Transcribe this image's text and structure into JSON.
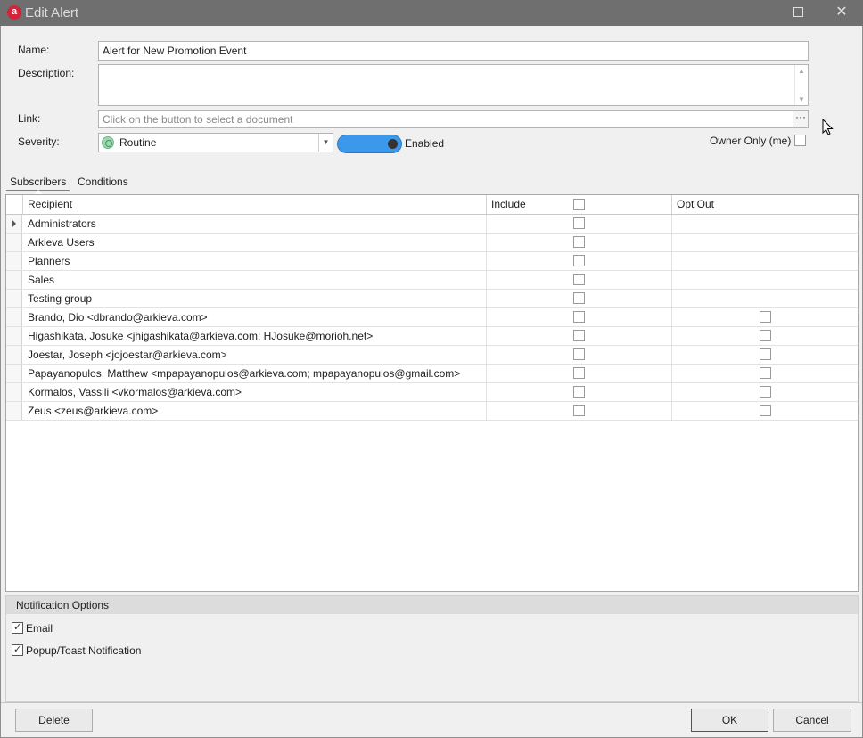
{
  "window": {
    "title": "Edit Alert",
    "logo_letter": "a"
  },
  "form": {
    "name_label": "Name:",
    "name_value": "Alert for New Promotion Event",
    "description_label": "Description:",
    "description_value": "",
    "link_label": "Link:",
    "link_placeholder": "Click on the button to select a document",
    "link_button": "···",
    "severity_label": "Severity:",
    "severity_value": "Routine",
    "enabled_label": "Enabled",
    "enabled": true,
    "owner_only_label": "Owner Only (me)",
    "owner_only": false
  },
  "tabs": [
    {
      "label": "Subscribers",
      "active": true
    },
    {
      "label": "Conditions",
      "active": false
    }
  ],
  "grid": {
    "columns": [
      "Recipient",
      "Include",
      "Opt Out"
    ],
    "include_all": false,
    "rows": [
      {
        "recipient": "Administrators",
        "include": false,
        "optout": null,
        "current": true
      },
      {
        "recipient": "Arkieva Users",
        "include": false,
        "optout": null
      },
      {
        "recipient": "Planners",
        "include": false,
        "optout": null
      },
      {
        "recipient": "Sales",
        "include": false,
        "optout": null
      },
      {
        "recipient": "Testing group",
        "include": false,
        "optout": null
      },
      {
        "recipient": "Brando, Dio <dbrando@arkieva.com>",
        "include": false,
        "optout": false
      },
      {
        "recipient": "Higashikata, Josuke <jhigashikata@arkieva.com; HJosuke@morioh.net>",
        "include": false,
        "optout": false
      },
      {
        "recipient": "Joestar, Joseph <jojoestar@arkieva.com>",
        "include": false,
        "optout": false
      },
      {
        "recipient": "Papayanopulos, Matthew <mpapayanopulos@arkieva.com; mpapayanopulos@gmail.com>",
        "include": false,
        "optout": false
      },
      {
        "recipient": "Kormalos, Vassili <vkormalos@arkieva.com>",
        "include": false,
        "optout": false
      },
      {
        "recipient": "Zeus <zeus@arkieva.com>",
        "include": false,
        "optout": false
      }
    ]
  },
  "notification": {
    "title": "Notification Options",
    "options": [
      {
        "label": "Email",
        "checked": true
      },
      {
        "label": "Popup/Toast Notification",
        "checked": true
      }
    ]
  },
  "footer": {
    "delete_label": "Delete",
    "ok_label": "OK",
    "cancel_label": "Cancel"
  },
  "colors": {
    "toggle": "#3b98ea",
    "titlebar": "#6f6f6f",
    "logo": "#d2253b"
  },
  "icons": {
    "severity": "routine-circle-icon",
    "window_close": "close-icon",
    "window_maximize": "maximize-icon"
  }
}
